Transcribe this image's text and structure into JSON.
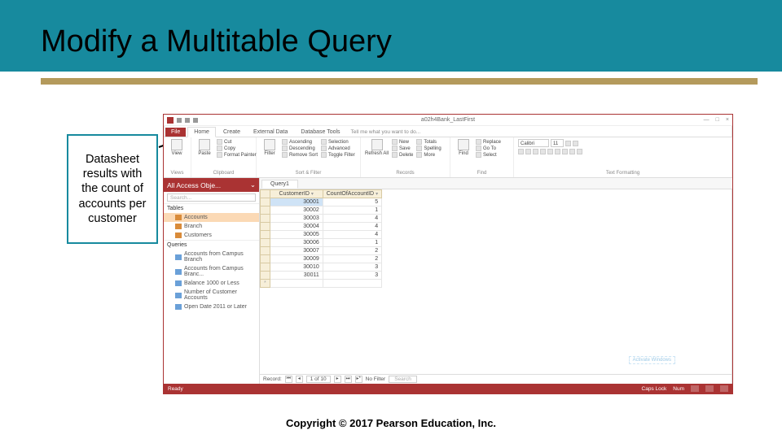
{
  "slide": {
    "title": "Modify a Multitable Query",
    "callout": "Datasheet results with the count of accounts per customer",
    "copyright": "Copyright © 2017 Pearson Education, Inc."
  },
  "app": {
    "filename": "a02h4Bank_LastFirst",
    "window_buttons": {
      "min": "—",
      "max": "□",
      "close": "×"
    },
    "tabs": {
      "file": "File",
      "home": "Home",
      "create": "Create",
      "external": "External Data",
      "tools": "Database Tools",
      "tell": "Tell me what you want to do..."
    },
    "ribbon": {
      "views": {
        "label": "Views",
        "view": "View"
      },
      "clipboard": {
        "label": "Clipboard",
        "paste": "Paste",
        "cut": "Cut",
        "copy": "Copy",
        "painter": "Format Painter"
      },
      "sort": {
        "label": "Sort & Filter",
        "filter": "Filter",
        "asc": "Ascending",
        "desc": "Descending",
        "remove": "Remove Sort",
        "selection": "Selection",
        "advanced": "Advanced",
        "toggle": "Toggle Filter"
      },
      "records": {
        "label": "Records",
        "refresh": "Refresh All",
        "new": "New",
        "save": "Save",
        "delete": "Delete",
        "totals": "Totals",
        "spelling": "Spelling",
        "more": "More"
      },
      "find": {
        "label": "Find",
        "find": "Find",
        "replace": "Replace",
        "goto": "Go To",
        "select": "Select"
      },
      "text": {
        "label": "Text Formatting",
        "font": "Calibri",
        "size": "11"
      }
    },
    "nav": {
      "header": "All Access Obje...",
      "search": "Search...",
      "cat_tables": "Tables",
      "cat_queries": "Queries",
      "tables": [
        "Accounts",
        "Branch",
        "Customers"
      ],
      "queries": [
        "Accounts from Campus Branch",
        "Accounts from Campus Branc...",
        "Balance 1000 or Less",
        "Number of Customer Accounts",
        "Open Date 2011 or Later"
      ]
    },
    "doc_tab": "Query1",
    "columns": {
      "c1": "CustomerID",
      "c2": "CountOfAccountID"
    },
    "rows": [
      {
        "id": "30001",
        "cnt": "5"
      },
      {
        "id": "30002",
        "cnt": "1"
      },
      {
        "id": "30003",
        "cnt": "4"
      },
      {
        "id": "30004",
        "cnt": "4"
      },
      {
        "id": "30005",
        "cnt": "4"
      },
      {
        "id": "30006",
        "cnt": "1"
      },
      {
        "id": "30007",
        "cnt": "2"
      },
      {
        "id": "30009",
        "cnt": "2"
      },
      {
        "id": "30010",
        "cnt": "3"
      },
      {
        "id": "30011",
        "cnt": "3"
      }
    ],
    "recnav": {
      "label": "Record:",
      "pos": "1 of 10",
      "nofilter": "No Filter",
      "search": "Search"
    },
    "status": {
      "ready": "Ready",
      "caps": "Caps Lock",
      "num": "Num"
    },
    "activate": "Activate Windows"
  }
}
